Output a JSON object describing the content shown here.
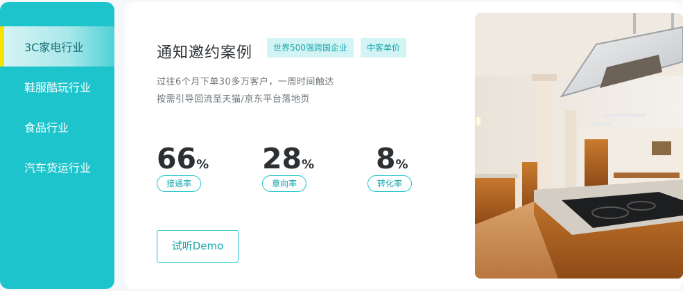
{
  "sidebar": {
    "items": [
      {
        "label": "3C家电行业",
        "active": true
      },
      {
        "label": "鞋服酷玩行业",
        "active": false
      },
      {
        "label": "食品行业",
        "active": false
      },
      {
        "label": "汽车货运行业",
        "active": false
      }
    ]
  },
  "case": {
    "title": "通知邀约案例",
    "tags": [
      "世界500强跨国企业",
      "中客单价"
    ],
    "desc_line1": "过往6个月下单30多万客户，一周时间触达",
    "desc_line2": "按需引导回流至天猫/京东平台落地页",
    "stats": [
      {
        "value": "66",
        "unit": "%",
        "label": "接通率"
      },
      {
        "value": "28",
        "unit": "%",
        "label": "意向率"
      },
      {
        "value": "8",
        "unit": "%",
        "label": "转化率"
      }
    ],
    "demo_button": "试听Demo"
  },
  "colors": {
    "accent": "#1ec4cb",
    "active_bar": "#f5e300",
    "tag_bg": "#d3f4f5"
  },
  "image": {
    "subject": "kitchen-interior-photo"
  }
}
